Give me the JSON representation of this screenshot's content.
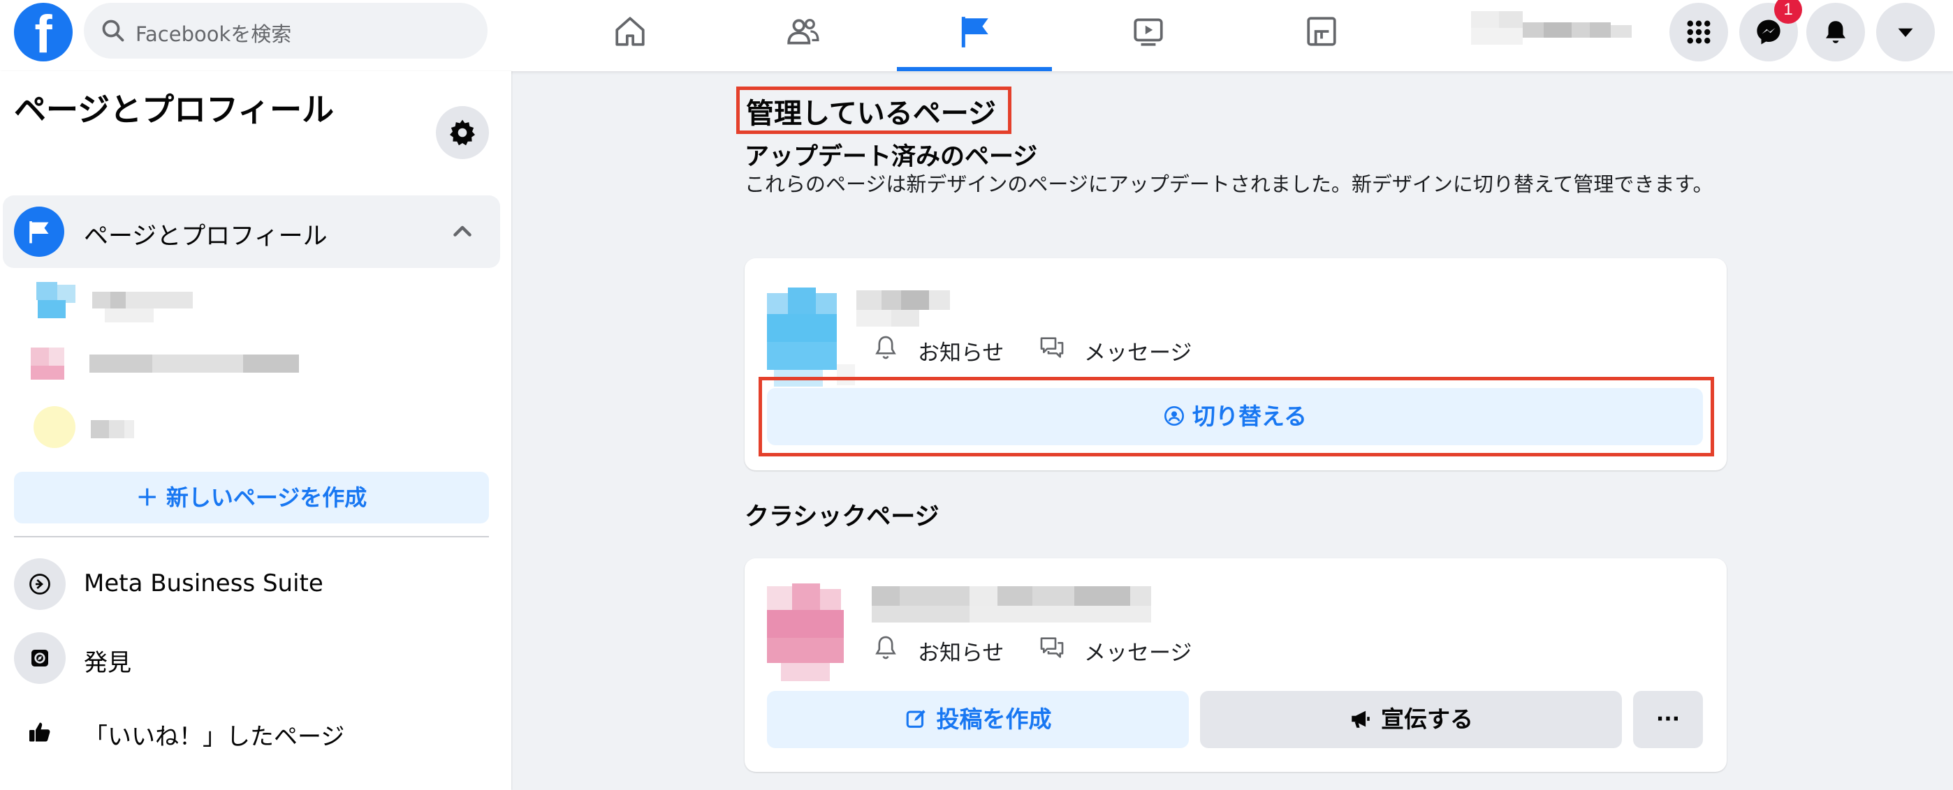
{
  "header": {
    "logo_letter": "f",
    "search_placeholder": "Facebookを検索",
    "messenger_badge": "1",
    "nav_icons": [
      "home-icon",
      "friends-icon",
      "pages-flag-icon",
      "watch-icon",
      "gaming-icon"
    ],
    "right_icons": [
      "menu-grid-icon",
      "messenger-icon",
      "notifications-icon",
      "account-dropdown-icon"
    ]
  },
  "sidebar": {
    "title": "ページとプロフィール",
    "section_label": "ページとプロフィール",
    "create_button": "＋ 新しいページを作成",
    "items": [
      {
        "label": "Meta Business Suite",
        "icon": "business-suite-icon"
      },
      {
        "label": "発見",
        "icon": "discover-icon"
      },
      {
        "label": "「いいね！」したページ",
        "icon": "thumbs-up-icon"
      }
    ]
  },
  "main": {
    "heading": "管理しているページ",
    "updated_heading": "アップデート済みのページ",
    "updated_description": "これらのページは新デザインのページにアップデートされました。新デザインに切り替えて管理できます。",
    "notifications_label": "お知らせ",
    "messages_label": "メッセージ",
    "switch_button": "切り替える",
    "classic_heading": "クラシックページ",
    "create_post_button": "投稿を作成",
    "promote_button": "宣伝する",
    "more_button": "···"
  },
  "colors": {
    "brand_blue": "#1877f2",
    "highlight_red": "#e4402b",
    "light_blue_button": "#e7f3ff",
    "page_background": "#f0f2f5"
  }
}
